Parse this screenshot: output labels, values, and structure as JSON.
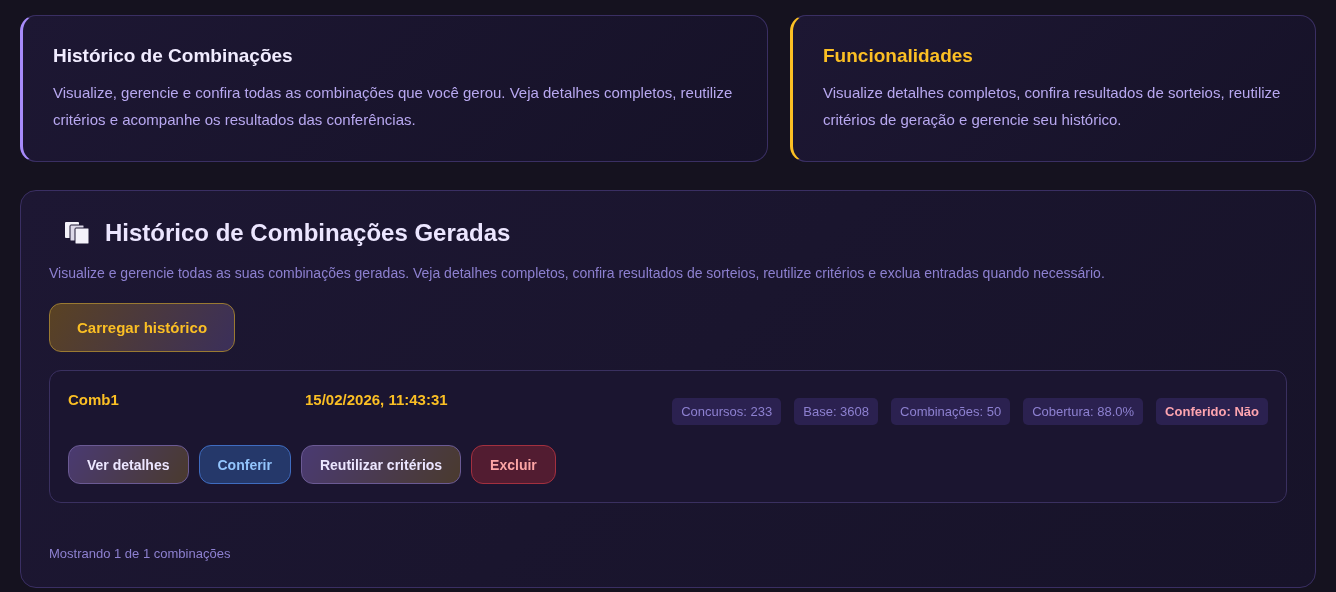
{
  "info_cards": [
    {
      "kind": "primary",
      "title": "Histórico de Combinações",
      "text": "Visualize, gerencie e confira todas as combinações que você gerou. Veja detalhes completos, reutilize critérios e acompanhe os resultados das conferências."
    },
    {
      "kind": "warning",
      "title": "Funcionalidades",
      "text": "Visualize detalhes completos, confira resultados de sorteios, reutilize critérios de geração e gerencie seu histórico."
    }
  ],
  "panel": {
    "title": "Histórico de Combinações Geradas",
    "description": "Visualize e gerencie todas as suas combinações geradas. Veja detalhes completos, confira resultados de sorteios, reutilize critérios e exclua entradas quando necessário.",
    "load_button": "Carregar histórico",
    "entries": [
      {
        "name": "Comb1",
        "date": "15/02/2026, 11:43:31",
        "chips": [
          {
            "kind": "stat",
            "text": "Concursos: 233"
          },
          {
            "kind": "stat",
            "text": "Base: 3608"
          },
          {
            "kind": "stat",
            "text": "Combinações: 50"
          },
          {
            "kind": "stat",
            "text": "Cobertura: 88.0%"
          },
          {
            "kind": "status",
            "text": "Conferido: Não"
          }
        ],
        "actions": [
          {
            "kind": "neutral",
            "label": "Ver detalhes"
          },
          {
            "kind": "info",
            "label": "Conferir"
          },
          {
            "kind": "neutral",
            "label": "Reutilizar critérios"
          },
          {
            "kind": "danger",
            "label": "Excluir"
          }
        ]
      }
    ],
    "footer": "Mostrando 1 de 1 combinações"
  }
}
